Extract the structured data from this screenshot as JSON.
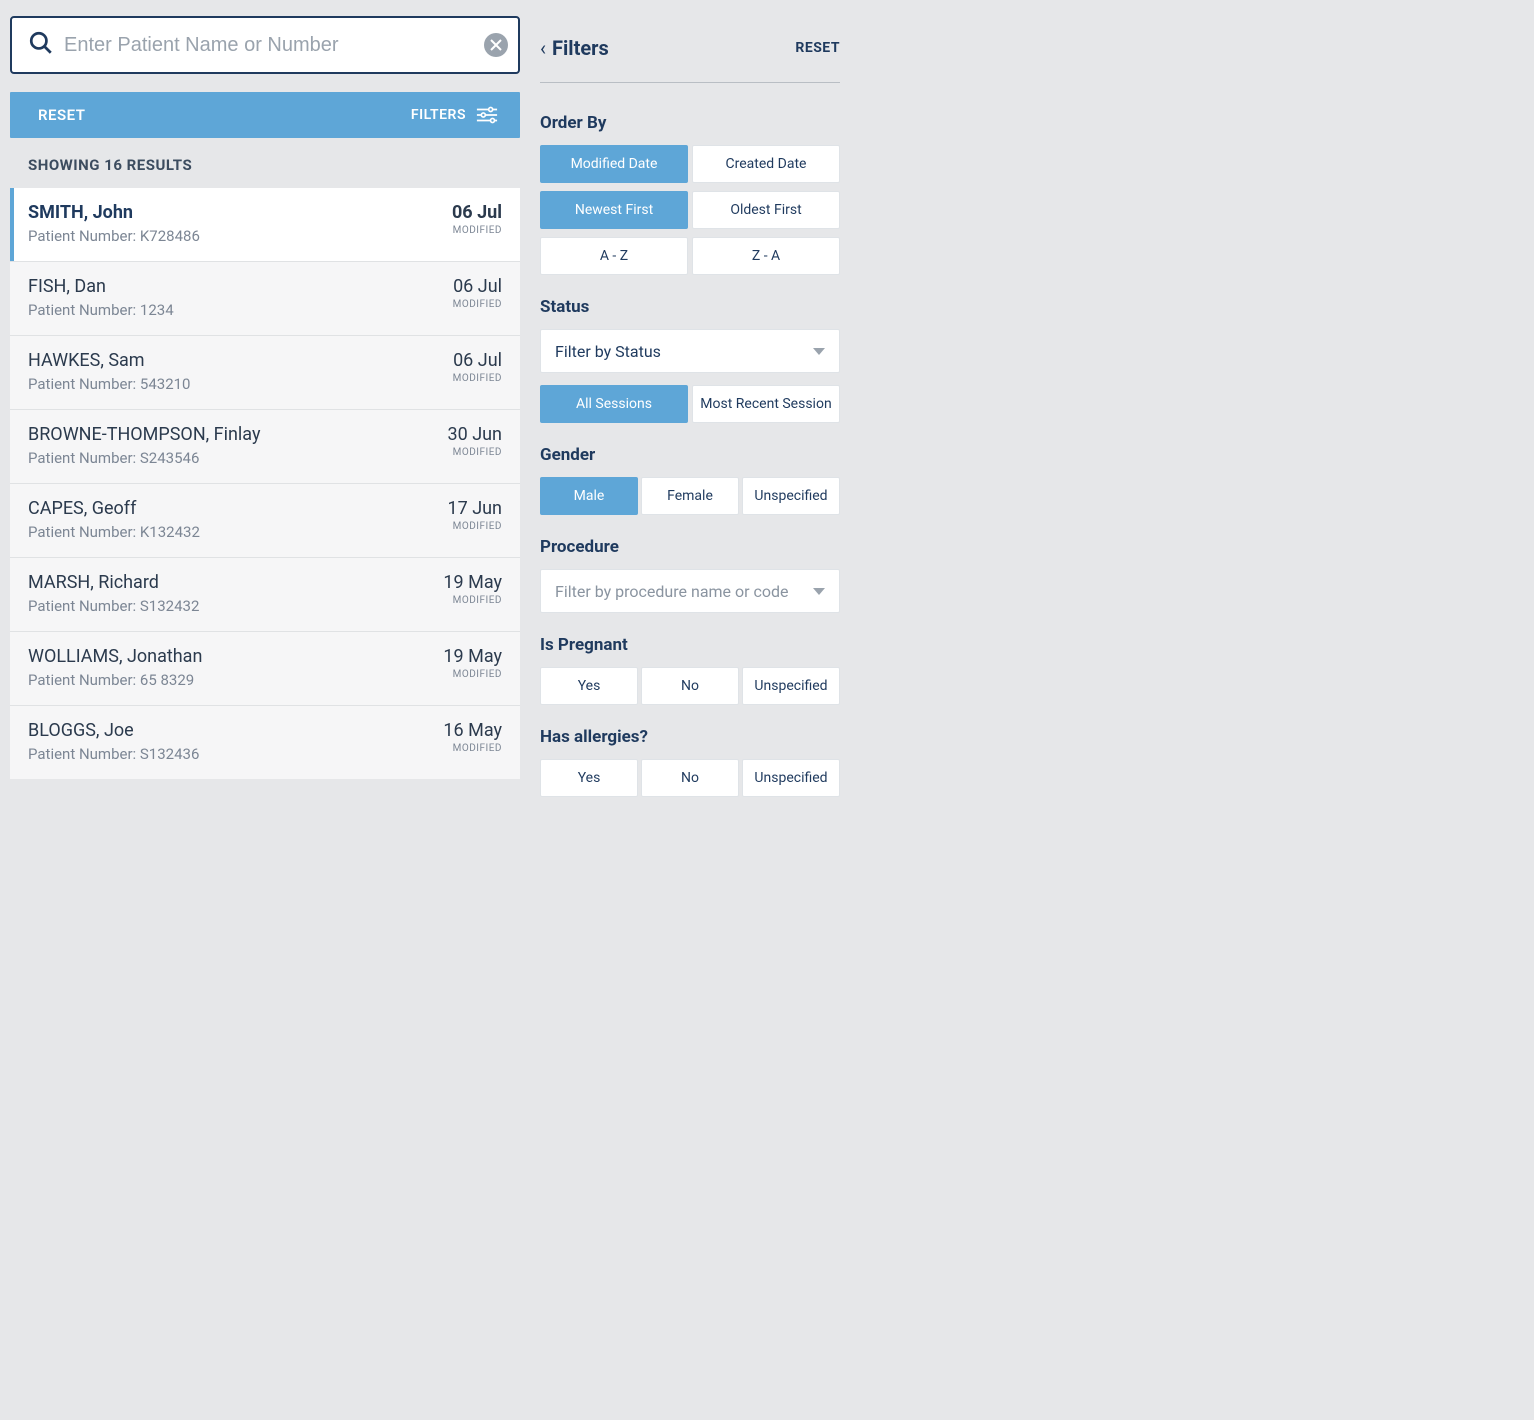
{
  "search": {
    "placeholder": "Enter Patient Name or Number"
  },
  "bluebar": {
    "reset": "RESET",
    "filters": "FILTERS"
  },
  "results_header": "SHOWING 16 RESULTS",
  "patients": [
    {
      "name": "SMITH, John",
      "number_label": "Patient Number: K728486",
      "date": "06 Jul",
      "mod": "MODIFIED",
      "selected": true
    },
    {
      "name": "FISH, Dan",
      "number_label": "Patient Number: 1234",
      "date": "06 Jul",
      "mod": "MODIFIED"
    },
    {
      "name": "HAWKES, Sam",
      "number_label": "Patient Number: 543210",
      "date": "06 Jul",
      "mod": "MODIFIED"
    },
    {
      "name": "BROWNE-THOMPSON, Finlay",
      "number_label": "Patient Number: S243546",
      "date": "30 Jun",
      "mod": "MODIFIED"
    },
    {
      "name": "CAPES, Geoff",
      "number_label": "Patient Number: K132432",
      "date": "17 Jun",
      "mod": "MODIFIED"
    },
    {
      "name": "MARSH, Richard",
      "number_label": "Patient Number: S132432",
      "date": "19 May",
      "mod": "MODIFIED"
    },
    {
      "name": "WOLLIAMS, Jonathan",
      "number_label": "Patient Number: 65 8329",
      "date": "19 May",
      "mod": "MODIFIED"
    },
    {
      "name": "BLOGGS, Joe",
      "number_label": "Patient Number: S132436",
      "date": "16 May",
      "mod": "MODIFIED"
    }
  ],
  "filters": {
    "title": "Filters",
    "back_caret": "‹",
    "reset": "RESET",
    "order_by": {
      "label": "Order By",
      "row1": [
        "Modified Date",
        "Created Date"
      ],
      "row1_active": 0,
      "row2": [
        "Newest First",
        "Oldest First"
      ],
      "row2_active": 0,
      "row3": [
        "A - Z",
        "Z - A"
      ],
      "row3_active": -1
    },
    "status": {
      "label": "Status",
      "placeholder": "Filter by Status",
      "sessions": [
        "All Sessions",
        "Most Recent Session"
      ],
      "sessions_active": 0
    },
    "gender": {
      "label": "Gender",
      "options": [
        "Male",
        "Female",
        "Unspecified"
      ],
      "active": 0
    },
    "procedure": {
      "label": "Procedure",
      "placeholder": "Filter by procedure name or code"
    },
    "pregnant": {
      "label": "Is Pregnant",
      "options": [
        "Yes",
        "No",
        "Unspecified"
      ],
      "active": -1
    },
    "allergies": {
      "label": "Has allergies?",
      "options": [
        "Yes",
        "No",
        "Unspecified"
      ],
      "active": -1
    }
  }
}
